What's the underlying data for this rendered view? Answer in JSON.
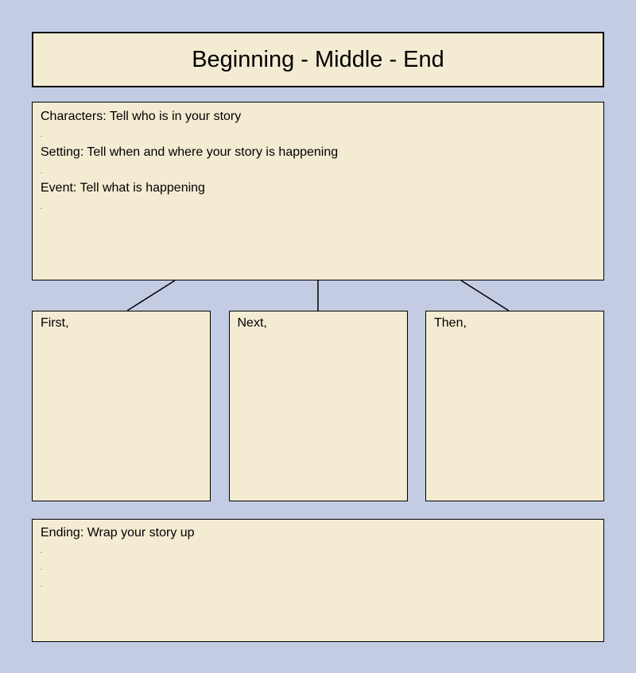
{
  "title": "Beginning - Middle - End",
  "intro": {
    "characters": "Characters: Tell who is in your story",
    "setting": "Setting: Tell when and where your story is happening",
    "event": "Event: Tell what is happening",
    "dot": "."
  },
  "middle": {
    "first": "First,",
    "next": "Next,",
    "then": "Then,"
  },
  "ending": {
    "label": "Ending: Wrap your story up",
    "dot": "."
  }
}
